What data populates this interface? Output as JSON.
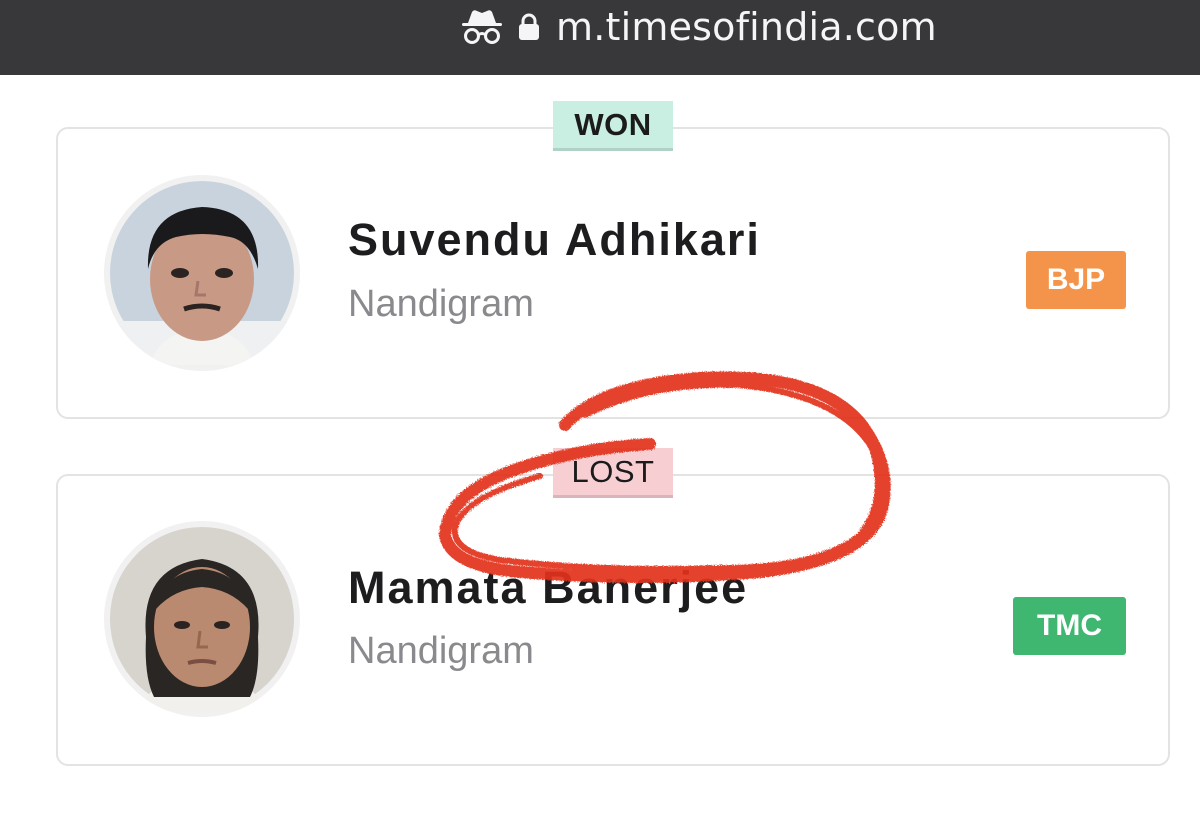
{
  "browser": {
    "url": "m.timesofindia.com",
    "icons": [
      "incognito-icon",
      "lock-icon"
    ]
  },
  "results": [
    {
      "status": "WON",
      "name": "Suvendu Adhikari",
      "constituency": "Nandigram",
      "party": "BJP",
      "party_color": "#f4944a",
      "status_color": "#c8efe1"
    },
    {
      "status": "LOST",
      "name": "Mamata Banerjee",
      "constituency": "Nandigram",
      "party": "TMC",
      "party_color": "#3fb771",
      "status_color": "#f7cfd3"
    }
  ],
  "annotation_color": "#e2321c"
}
